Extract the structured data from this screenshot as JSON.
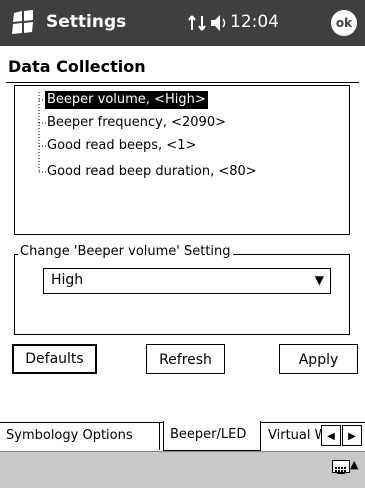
{
  "titlebar": {
    "title": "Settings",
    "time": "12:04",
    "ok_label": "ok"
  },
  "section": {
    "title": "Data Collection"
  },
  "tree": {
    "items": [
      {
        "label": "Beeper volume, <High>",
        "selected": true
      },
      {
        "label": "Beeper frequency, <2090>",
        "selected": false
      },
      {
        "label": "Good read beeps, <1>",
        "selected": false
      },
      {
        "label": "Good read beep duration, <80>",
        "selected": false
      }
    ]
  },
  "setting_group": {
    "label": "Change 'Beeper volume' Setting",
    "dropdown_value": "High"
  },
  "buttons": {
    "defaults": "Defaults",
    "refresh": "Refresh",
    "apply": "Apply"
  },
  "tabs": [
    {
      "label": "Symbology Options",
      "active": false
    },
    {
      "label": "Beeper/LED",
      "active": true
    },
    {
      "label": "Virtual W",
      "active": false
    }
  ],
  "icons": {
    "start": "windows-flag-icon",
    "connectivity": "connectivity-icon",
    "volume": "speaker-icon",
    "keyboard": "keyboard-icon"
  },
  "colors": {
    "titlebar_bg": "#3f3f3f",
    "menubar_bg": "#c8c8c8"
  }
}
